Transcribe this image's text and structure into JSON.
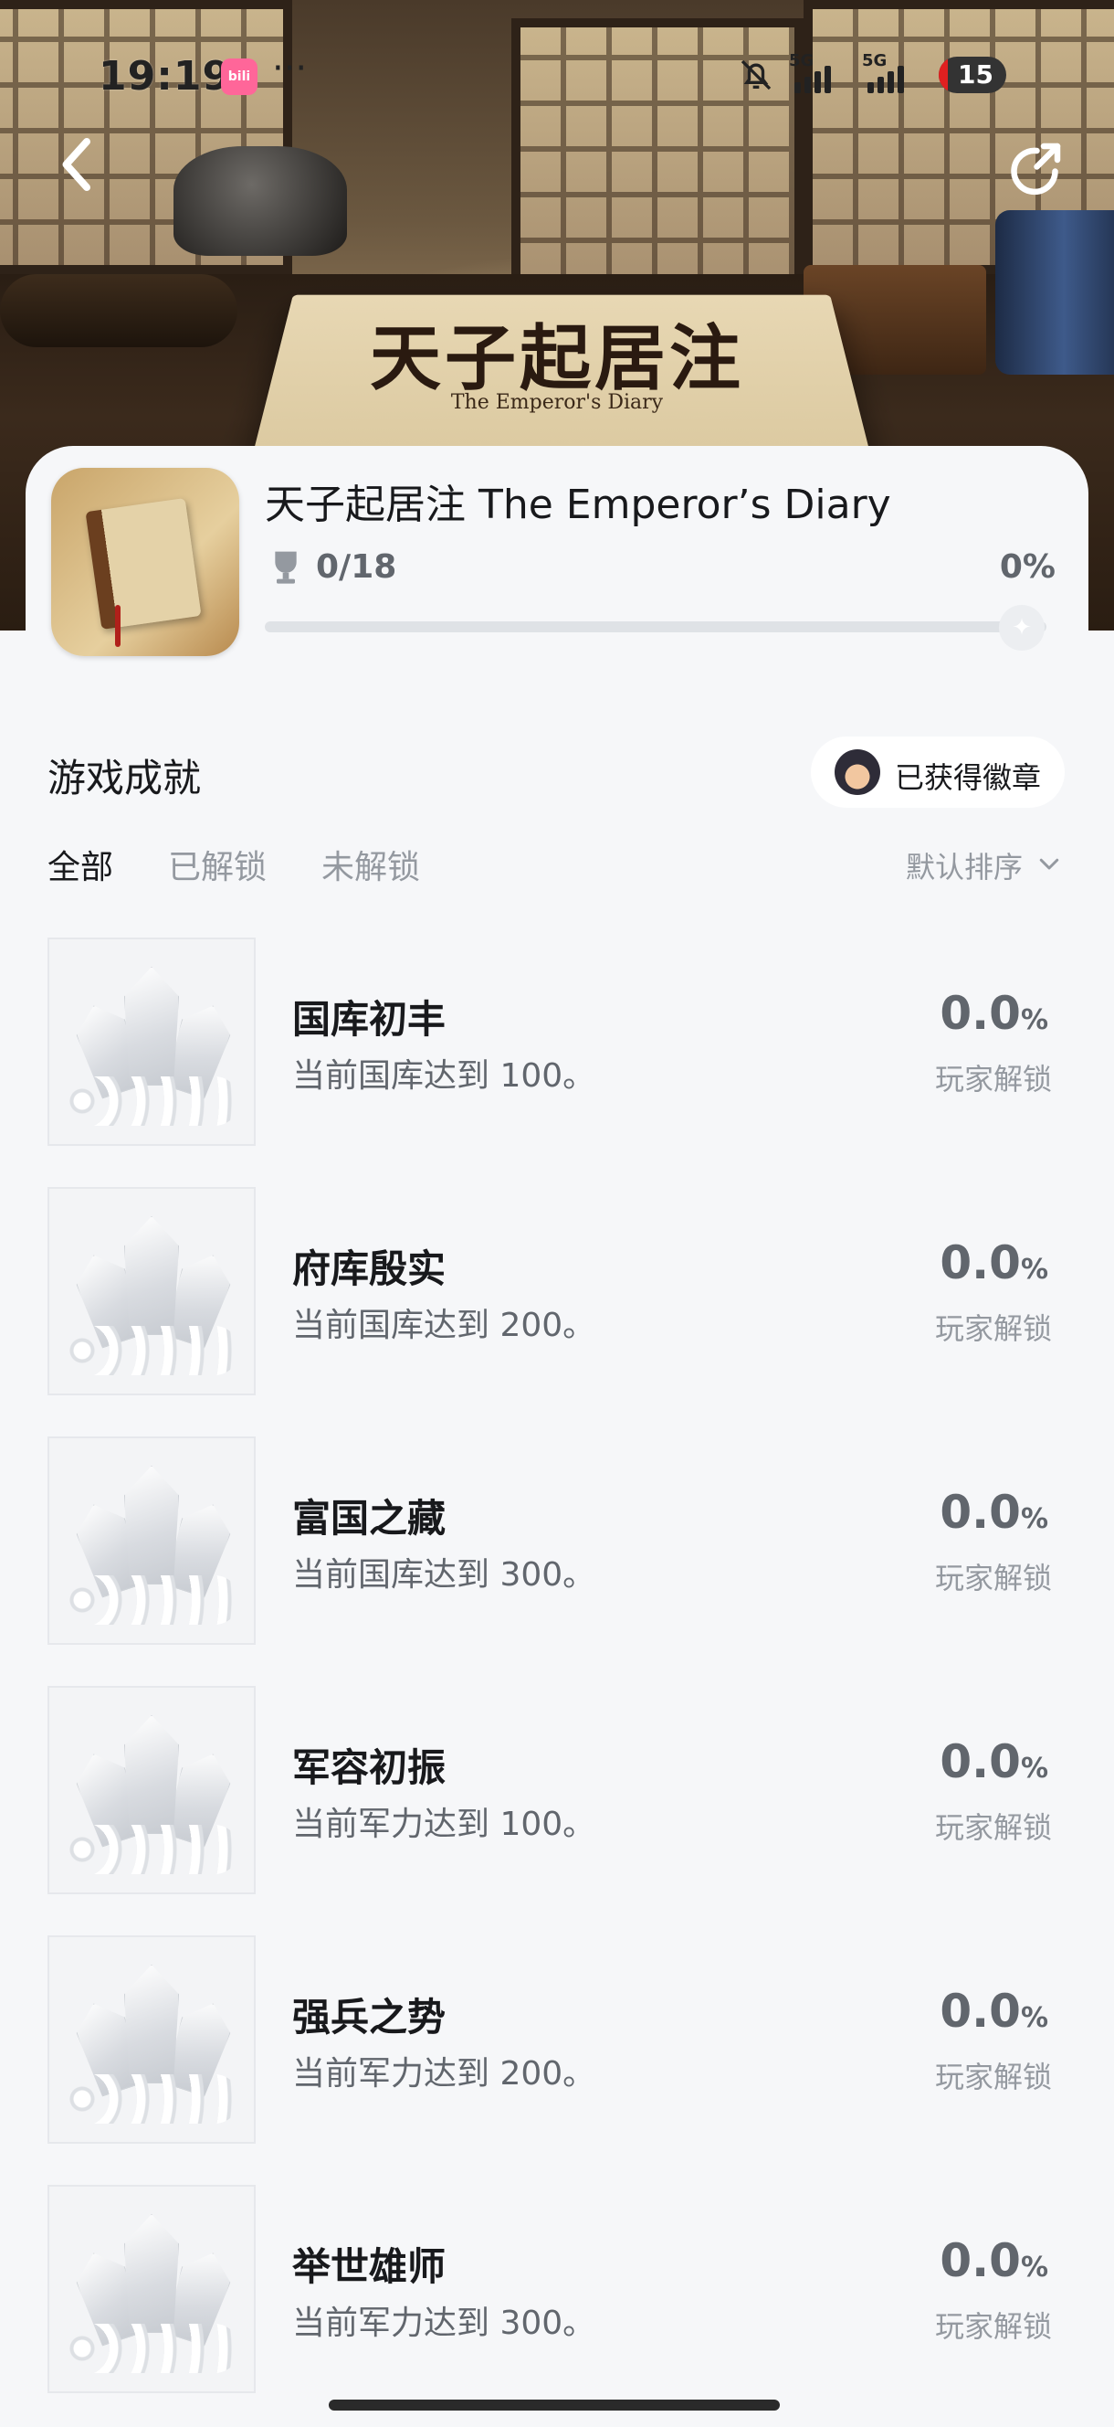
{
  "status_bar": {
    "time": "19:19",
    "app_icon_text": "bili",
    "more": "···",
    "signal_1": "5G",
    "signal_2": "5G",
    "battery": "15"
  },
  "hero": {
    "book_title": "天子起居注",
    "book_subtitle": "The Emperor's Diary"
  },
  "game": {
    "title": "天子起居注 The Emperor’s Diary",
    "achievement_count": "0/18",
    "progress_percent": "0%",
    "progress_value": 0
  },
  "section": {
    "title": "游戏成就",
    "badge_button": "已获得徽章",
    "tabs": [
      "全部",
      "已解锁",
      "未解锁"
    ],
    "active_tab": "全部",
    "sort_label": "默认排序"
  },
  "achievements": [
    {
      "name": "国库初丰",
      "desc": "当前国库达到 100。",
      "rate": "0.0",
      "pct": "%",
      "unlock_label": "玩家解锁"
    },
    {
      "name": "府库殷实",
      "desc": "当前国库达到 200。",
      "rate": "0.0",
      "pct": "%",
      "unlock_label": "玩家解锁"
    },
    {
      "name": "富国之藏",
      "desc": "当前国库达到 300。",
      "rate": "0.0",
      "pct": "%",
      "unlock_label": "玩家解锁"
    },
    {
      "name": "军容初振",
      "desc": "当前军力达到 100。",
      "rate": "0.0",
      "pct": "%",
      "unlock_label": "玩家解锁"
    },
    {
      "name": "强兵之势",
      "desc": "当前军力达到 200。",
      "rate": "0.0",
      "pct": "%",
      "unlock_label": "玩家解锁"
    },
    {
      "name": "举世雄师",
      "desc": "当前军力达到 300。",
      "rate": "0.0",
      "pct": "%",
      "unlock_label": "玩家解锁"
    }
  ],
  "icons": {
    "back": "chevron-left-icon",
    "share": "share-icon",
    "trophy": "trophy-icon",
    "sort": "chevron-down-icon",
    "mute": "bell-muted-icon"
  }
}
